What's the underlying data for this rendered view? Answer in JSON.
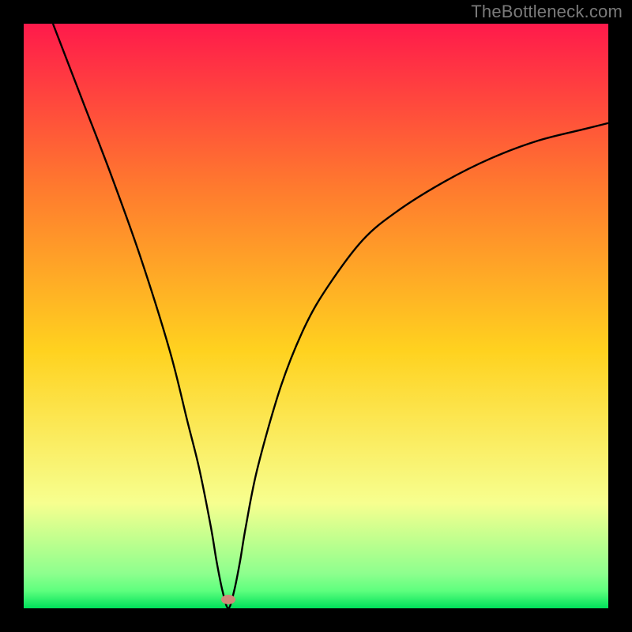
{
  "watermark": "TheBottleneck.com",
  "chart_data": {
    "type": "line",
    "title": "",
    "xlabel": "",
    "ylabel": "",
    "xlim": [
      0,
      100
    ],
    "ylim": [
      0,
      100
    ],
    "grid": false,
    "legend": false,
    "background_gradient": {
      "top": "#ff1a4b",
      "upper_mid": "#ff7a2e",
      "mid": "#ffd21f",
      "lower_mid": "#f7ff8f",
      "green_band": "#8eff8e",
      "bottom": "#00e05a"
    },
    "series": [
      {
        "name": "bottleneck-curve",
        "color": "#000000",
        "x": [
          5,
          10,
          15,
          20,
          25,
          28,
          30,
          32,
          33,
          34,
          35,
          36,
          37,
          38,
          40,
          44,
          48,
          52,
          58,
          64,
          72,
          80,
          88,
          96,
          100
        ],
        "y": [
          100,
          87,
          74,
          60,
          44,
          32,
          24,
          14,
          8,
          3,
          0,
          3,
          8,
          14,
          24,
          38,
          48,
          55,
          63,
          68,
          73,
          77,
          80,
          82,
          83
        ]
      }
    ],
    "marker": {
      "name": "optimum-point",
      "x": 35,
      "y": 1.5,
      "color": "#d08a7a",
      "shape": "ellipse"
    }
  }
}
